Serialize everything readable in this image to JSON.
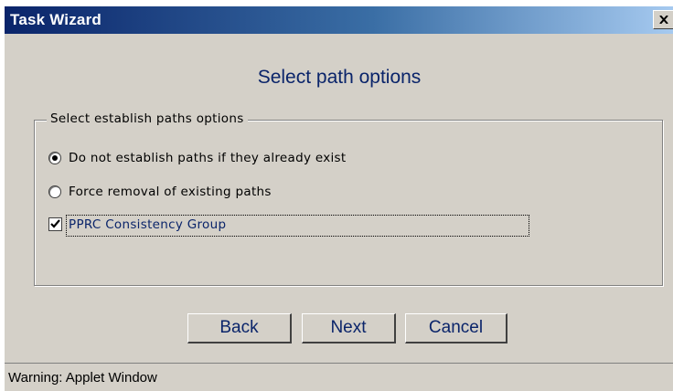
{
  "window": {
    "title": "Task Wizard",
    "close_icon": "close-icon"
  },
  "heading": "Select path options",
  "group": {
    "legend": "Select establish paths options",
    "options": [
      {
        "label": "Do not establish paths if they already exist",
        "type": "radio",
        "selected": true
      },
      {
        "label": "Force removal of existing paths",
        "type": "radio",
        "selected": false
      },
      {
        "label": "PPRC Consistency Group",
        "type": "checkbox",
        "checked": true
      }
    ]
  },
  "buttons": {
    "back": "Back",
    "next": "Next",
    "cancel": "Cancel"
  },
  "status": "Warning: Applet Window",
  "colors": {
    "title_gradient_start": "#0a246a",
    "title_gradient_end": "#a6caf0",
    "window_bg": "#d4d0c8",
    "heading_text": "#0a246a"
  }
}
